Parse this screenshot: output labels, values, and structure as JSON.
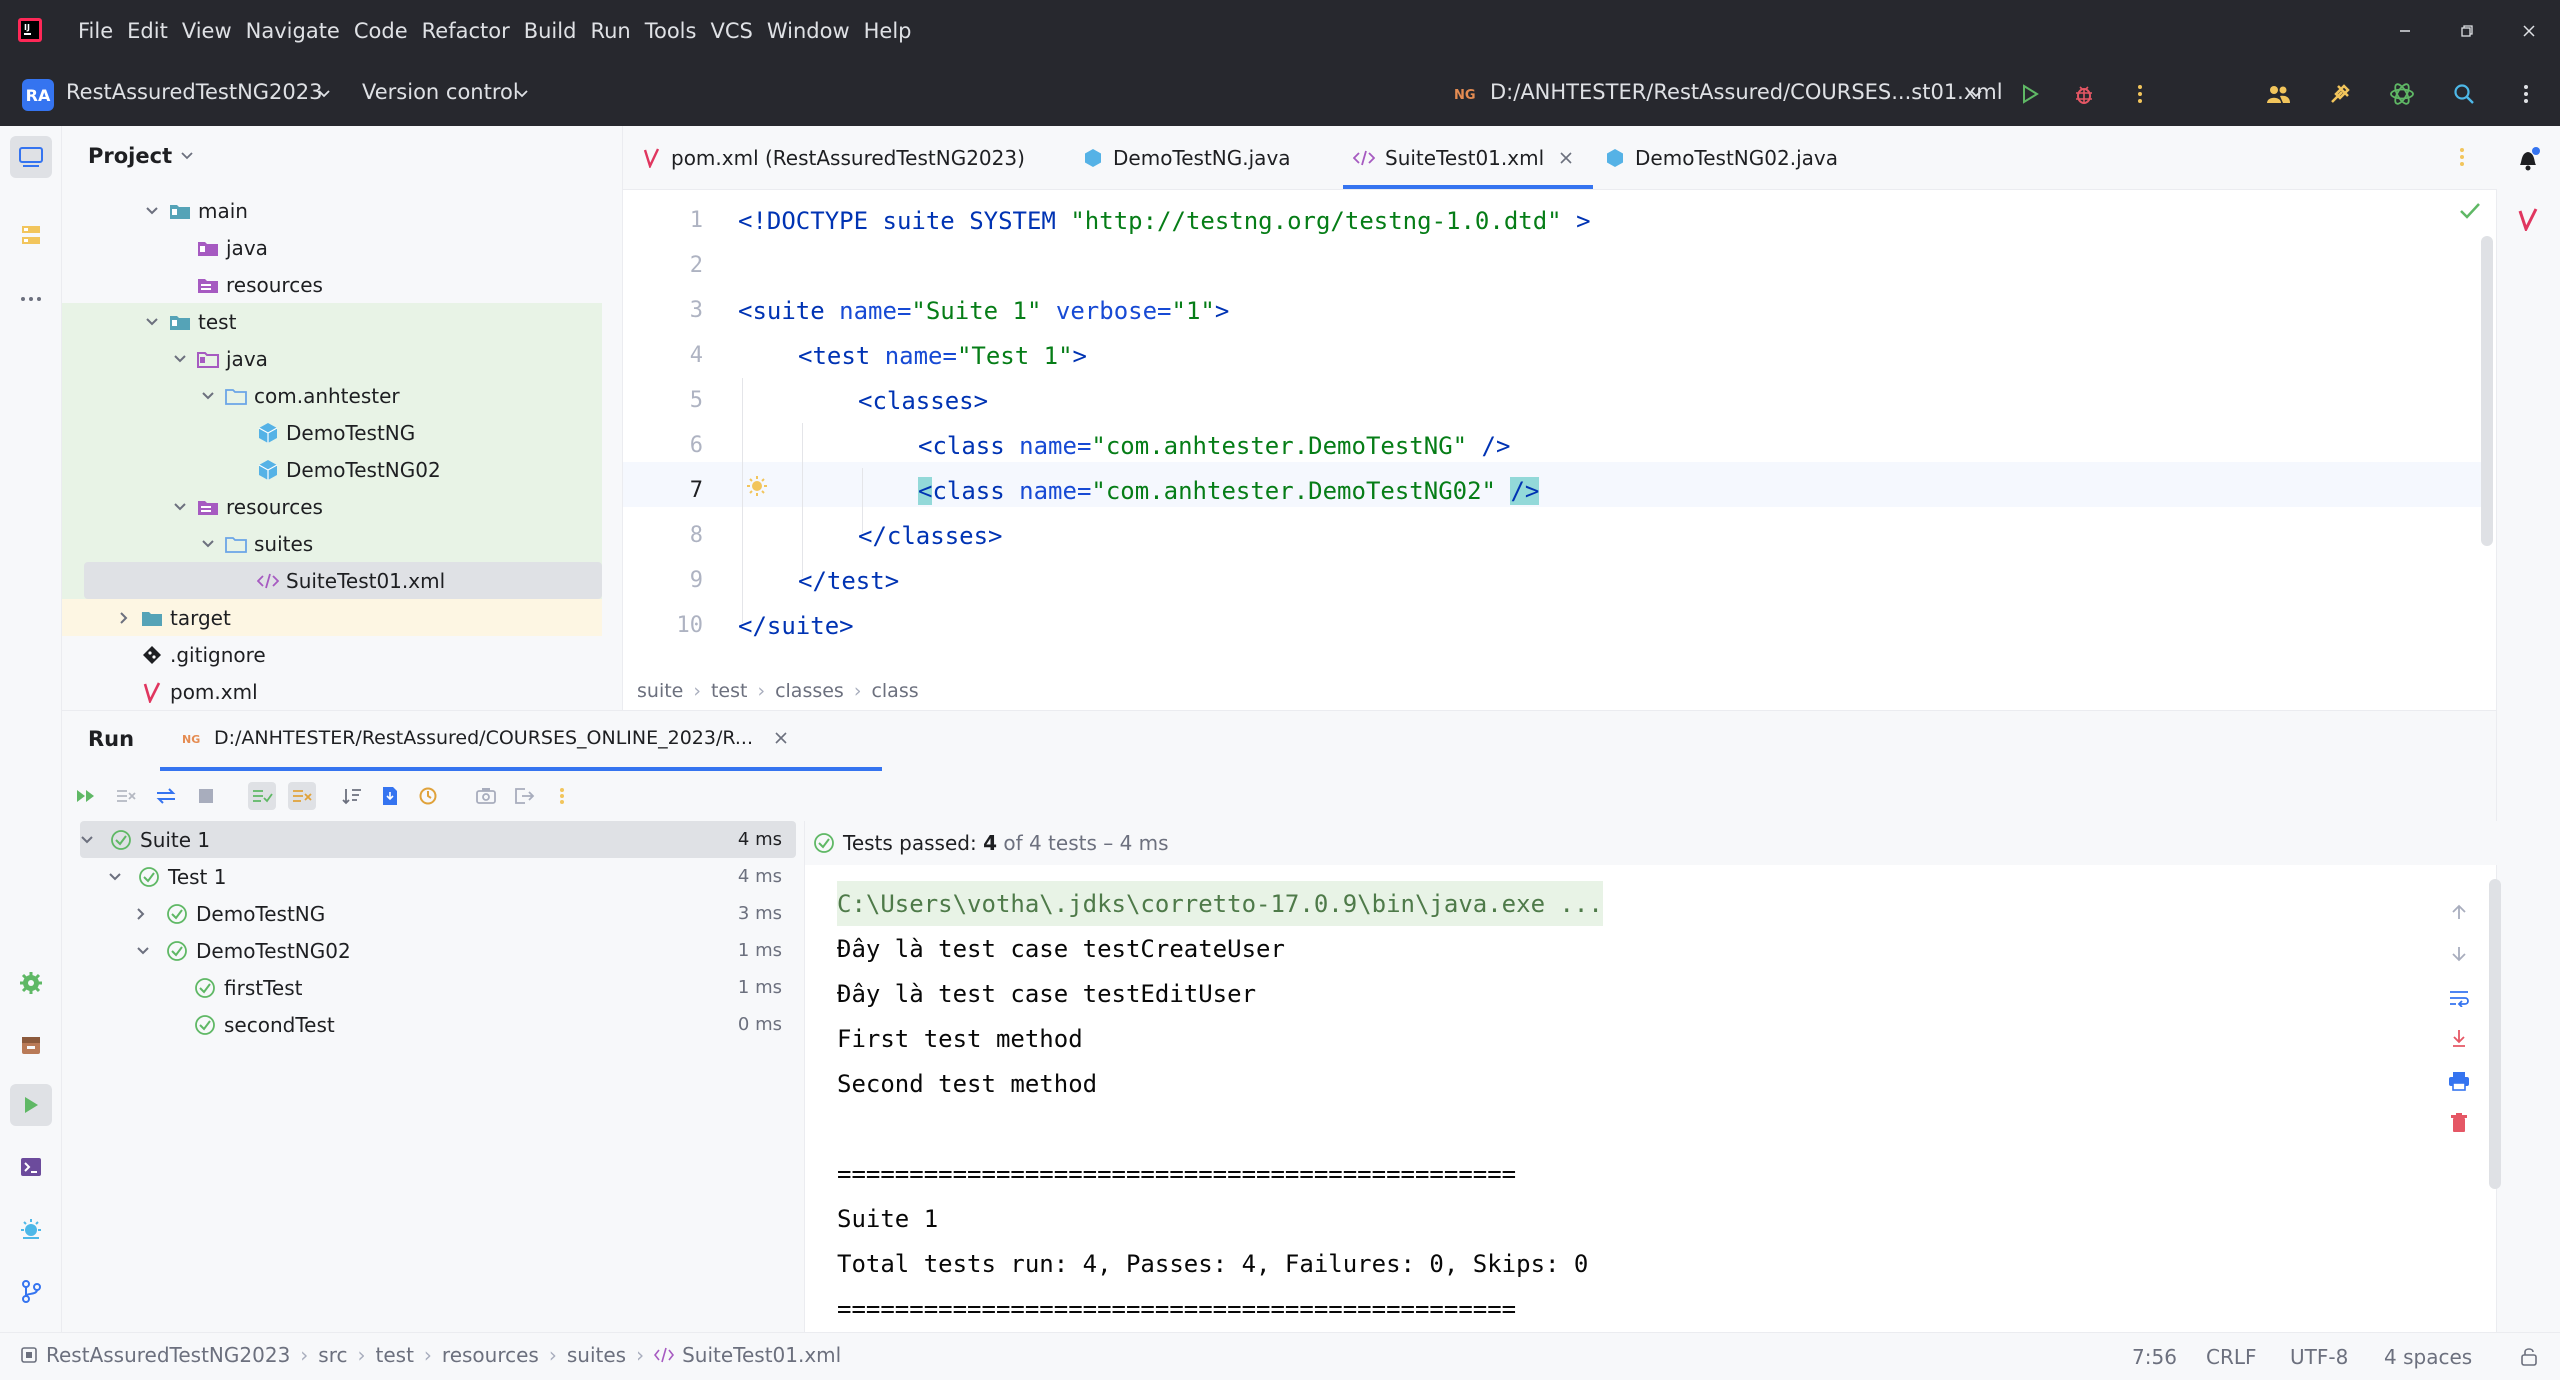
{
  "menu": [
    "File",
    "Edit",
    "View",
    "Navigate",
    "Code",
    "Refactor",
    "Build",
    "Run",
    "Tools",
    "VCS",
    "Window",
    "Help"
  ],
  "toolbar": {
    "project_badge": "RA",
    "project_name": "RestAssuredTestNG2023",
    "vcs_label": "Version control",
    "run_config": "D:/ANHTESTER/RestAssured/COURSES...st01.xml"
  },
  "project_panel": {
    "title": "Project",
    "items": [
      {
        "label": "main"
      },
      {
        "label": "java"
      },
      {
        "label": "resources"
      },
      {
        "label": "test"
      },
      {
        "label": "java"
      },
      {
        "label": "com.anhtester"
      },
      {
        "label": "DemoTestNG"
      },
      {
        "label": "DemoTestNG02"
      },
      {
        "label": "resources"
      },
      {
        "label": "suites"
      },
      {
        "label": "SuiteTest01.xml"
      },
      {
        "label": "target"
      },
      {
        "label": ".gitignore"
      },
      {
        "label": "pom.xml"
      }
    ]
  },
  "editor": {
    "tabs": [
      {
        "label": "pom.xml (RestAssuredTestNG2023)"
      },
      {
        "label": "DemoTestNG.java"
      },
      {
        "label": "SuiteTest01.xml"
      },
      {
        "label": "DemoTestNG02.java"
      }
    ],
    "line_numbers": [
      "1",
      "2",
      "3",
      "4",
      "5",
      "6",
      "7",
      "8",
      "9",
      "10"
    ],
    "code": {
      "l1": {
        "a": "<!DOCTYPE suite SYSTEM ",
        "b": "\"http://testng.org/testng-1.0.dtd\"",
        "c": " >"
      },
      "l3": {
        "a": "<suite ",
        "b": "name=",
        "c": "\"Suite 1\"",
        "d": " verbose=",
        "e": "\"1\"",
        "f": ">"
      },
      "l4": {
        "a": "<test ",
        "b": "name=",
        "c": "\"Test 1\"",
        "d": ">"
      },
      "l5": {
        "a": "<classes>"
      },
      "l6": {
        "a": "<class ",
        "b": "name=",
        "c": "\"com.anhtester.DemoTestNG\"",
        "d": " />"
      },
      "l7": {
        "a": "<",
        "b": "class ",
        "c": "name=",
        "d": "\"com.anhtester.DemoTestNG02\"",
        "e": " ",
        "f": "/>"
      },
      "l8": {
        "a": "</classes>"
      },
      "l9": {
        "a": "</test>"
      },
      "l10": {
        "a": "</suite>"
      }
    },
    "breadcrumb": [
      "suite",
      "test",
      "classes",
      "class"
    ]
  },
  "run": {
    "tab_label": "Run",
    "config_tab": "D:/ANHTESTER/RestAssured/COURSES_ONLINE_2023/R...",
    "tests": [
      {
        "label": "Suite 1",
        "time": "4 ms"
      },
      {
        "label": "Test 1",
        "time": "4 ms"
      },
      {
        "label": "DemoTestNG",
        "time": "3 ms"
      },
      {
        "label": "DemoTestNG02",
        "time": "1 ms"
      },
      {
        "label": "firstTest",
        "time": "1 ms"
      },
      {
        "label": "secondTest",
        "time": "0 ms"
      }
    ],
    "status": {
      "prefix": "Tests passed: ",
      "count": "4",
      "suffix": " of 4 tests – 4 ms"
    },
    "console": [
      "C:\\Users\\votha\\.jdks\\corretto-17.0.9\\bin\\java.exe ...",
      "Đây là test case testCreateUser",
      "Đây là test case testEditUser",
      "First test method",
      "Second test method",
      "",
      "===============================================",
      "Suite 1",
      "Total tests run: 4, Passes: 4, Failures: 0, Skips: 0",
      "==============================================="
    ]
  },
  "statusbar": {
    "path": [
      "RestAssuredTestNG2023",
      "src",
      "test",
      "resources",
      "suites",
      "SuiteTest01.xml"
    ],
    "position": "7:56",
    "line_sep": "CRLF",
    "encoding": "UTF-8",
    "indent": "4 spaces"
  },
  "colors": {
    "accent": "#3574f0",
    "pass": "#5fb865",
    "tag": "#0033b3",
    "string": "#067d17"
  }
}
